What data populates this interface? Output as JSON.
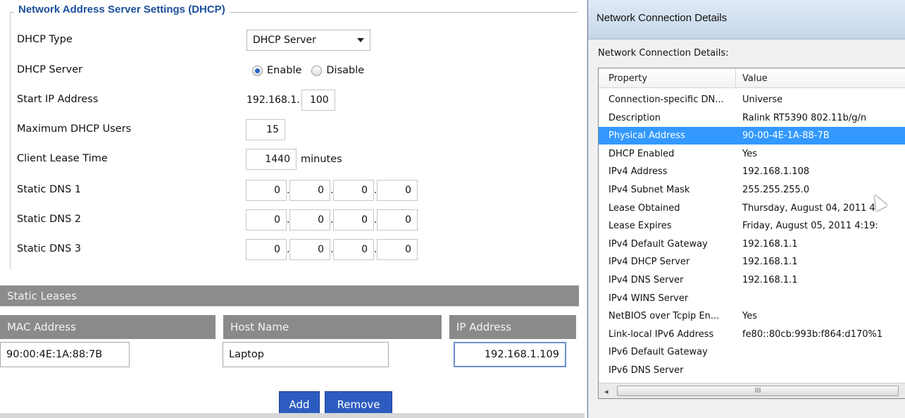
{
  "dhcp": {
    "legend": "Network Address Server Settings (DHCP)",
    "type_label": "DHCP Type",
    "type_value": "DHCP Server",
    "server_label": "DHCP Server",
    "enable_label": "Enable",
    "disable_label": "Disable",
    "start_ip_label": "Start IP Address",
    "start_ip_prefix": "192.168.1.",
    "start_ip_value": "100",
    "max_users_label": "Maximum DHCP Users",
    "max_users_value": "15",
    "lease_time_label": "Client Lease Time",
    "lease_time_value": "1440",
    "lease_time_unit": "minutes",
    "dns": [
      {
        "label": "Static DNS 1",
        "octets": [
          "0",
          "0",
          "0",
          "0"
        ]
      },
      {
        "label": "Static DNS 2",
        "octets": [
          "0",
          "0",
          "0",
          "0"
        ]
      },
      {
        "label": "Static DNS 3",
        "octets": [
          "0",
          "0",
          "0",
          "0"
        ]
      }
    ],
    "dot": "."
  },
  "leases": {
    "title": "Static Leases",
    "columns": [
      "MAC Address",
      "Host Name",
      "IP Address"
    ],
    "row": {
      "mac": "90:00:4E:1A:88:7B",
      "host": "Laptop",
      "ip": "192.168.1.109"
    },
    "add_label": "Add",
    "remove_label": "Remove"
  },
  "dialog": {
    "title": "Network Connection Details",
    "caption": "Network Connection Details:",
    "col_property": "Property",
    "col_value": "Value",
    "selected_index": 2,
    "items": [
      {
        "property": "Connection-specific DN...",
        "value": "Universe"
      },
      {
        "property": "Description",
        "value": "Ralink RT5390 802.11b/g/n"
      },
      {
        "property": "Physical Address",
        "value": "90-00-4E-1A-88-7B"
      },
      {
        "property": "DHCP Enabled",
        "value": "Yes"
      },
      {
        "property": "IPv4 Address",
        "value": "192.168.1.108"
      },
      {
        "property": "IPv4 Subnet Mask",
        "value": "255.255.255.0"
      },
      {
        "property": "Lease Obtained",
        "value": "Thursday, August 04, 2011 4:"
      },
      {
        "property": "Lease Expires",
        "value": "Friday, August 05, 2011 4:19:"
      },
      {
        "property": "IPv4 Default Gateway",
        "value": "192.168.1.1"
      },
      {
        "property": "IPv4 DHCP Server",
        "value": "192.168.1.1"
      },
      {
        "property": "IPv4 DNS Server",
        "value": "192.168.1.1"
      },
      {
        "property": "IPv4 WINS Server",
        "value": ""
      },
      {
        "property": "NetBIOS over Tcpip En...",
        "value": "Yes"
      },
      {
        "property": "Link-local IPv6 Address",
        "value": "fe80::80cb:993b:f864:d170%1"
      },
      {
        "property": "IPv6 Default Gateway",
        "value": ""
      },
      {
        "property": "IPv6 DNS Server",
        "value": ""
      }
    ],
    "scroll_grip": "III",
    "scroll_left": "◂"
  }
}
